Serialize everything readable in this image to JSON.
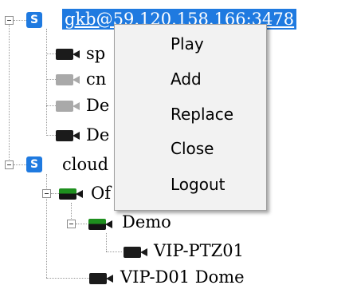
{
  "tree": {
    "server1": {
      "icon": "S",
      "label": "gkb@59.120.158.166:3478",
      "selected": true,
      "expanded": true,
      "children": [
        {
          "label": "sp",
          "camera_state": "online"
        },
        {
          "label": "cn",
          "camera_state": "offline"
        },
        {
          "label": "De",
          "camera_state": "offline"
        },
        {
          "label": "De",
          "camera_state": "online"
        }
      ]
    },
    "server2": {
      "icon": "S",
      "label": "cloud",
      "expanded": true,
      "group": {
        "label": "Of",
        "camera_state": "recording",
        "expanded": true,
        "subgroup": {
          "label": "Demo",
          "camera_state": "recording",
          "expanded": true,
          "children": [
            {
              "label": "VIP-PTZ01",
              "camera_state": "online"
            }
          ]
        },
        "children": [
          {
            "label": "VIP-D01 Dome",
            "camera_state": "online"
          }
        ]
      }
    }
  },
  "context_menu": {
    "items": [
      {
        "label": "Play"
      },
      {
        "label": "Add"
      },
      {
        "label": "Replace"
      },
      {
        "label": "Close"
      },
      {
        "label": "Logout"
      }
    ]
  },
  "colors": {
    "selection": "#1f7ae0",
    "server_icon": "#1f7ae0",
    "camera_online": "#1b1b1b",
    "camera_offline": "#a9a9a9",
    "camera_recording_top": "#1e8f1e",
    "menu_background": "#f2f2f2"
  }
}
